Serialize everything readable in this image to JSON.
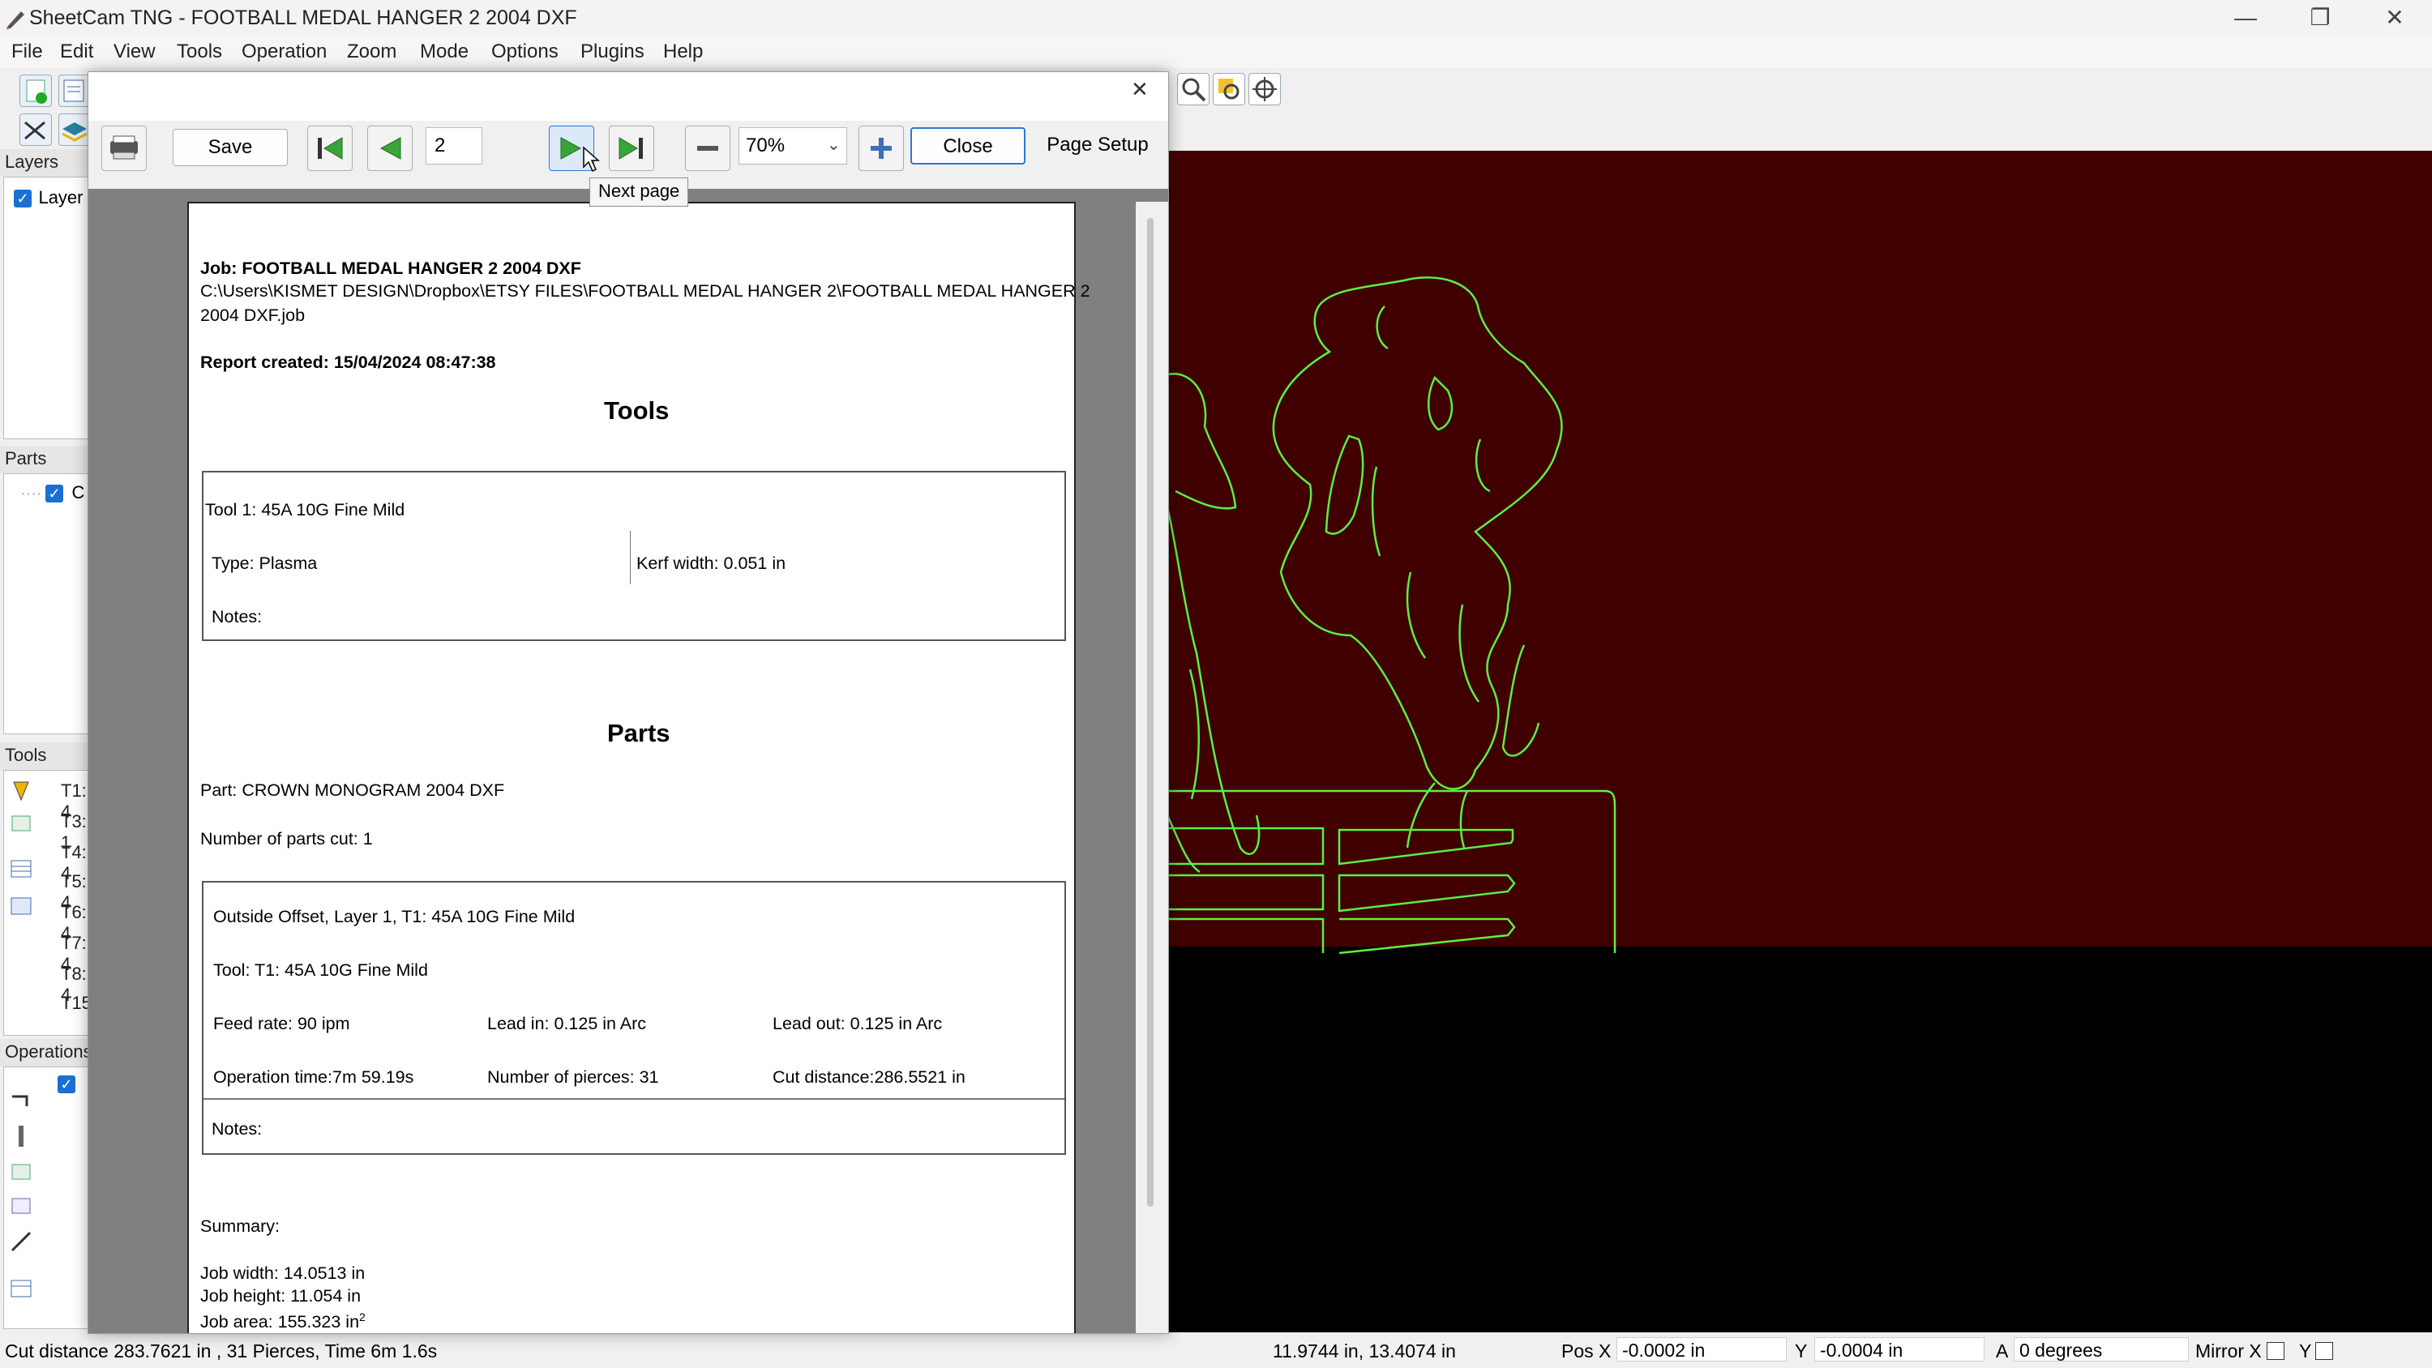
{
  "window": {
    "title": "SheetCam TNG - FOOTBALL MEDAL HANGER 2 2004 DXF",
    "minimize_glyph": "—",
    "restore_glyph": "❐",
    "close_glyph": "✕"
  },
  "menu": [
    "File",
    "Edit",
    "View",
    "Tools",
    "Operation",
    "Zoom",
    "Mode",
    "Options",
    "Plugins",
    "Help"
  ],
  "panels": {
    "layers": {
      "title": "Layers",
      "item": "Layer"
    },
    "parts": {
      "title": "Parts",
      "item": "C"
    },
    "tools": {
      "title": "Tools",
      "items": [
        "T1: 4",
        "T3: 1",
        "T4: 4",
        "T5: 4",
        "T6: 4",
        "T7: 4",
        "T8: 4",
        "T15"
      ]
    },
    "operations": {
      "title": "Operations"
    }
  },
  "dialog": {
    "close_glyph": "✕",
    "save_label": "Save",
    "page_number": "2",
    "zoom_value": "70%",
    "close_label": "Close",
    "page_setup_label": "Page Setup",
    "tooltip": "Next page"
  },
  "report": {
    "job_line": "Job: FOOTBALL MEDAL HANGER 2 2004 DXF",
    "path_line1": "C:\\Users\\KISMET DESIGN\\Dropbox\\ETSY FILES\\FOOTBALL MEDAL HANGER 2\\FOOTBALL MEDAL HANGER 2",
    "path_line2": "2004 DXF.job",
    "created": "Report created: 15/04/2024 08:47:38",
    "tools_heading": "Tools",
    "tool1": "Tool 1: 45A 10G Fine Mild",
    "type": "Type: Plasma",
    "kerf": "Kerf width: 0.051 in",
    "notes": "Notes:",
    "parts_heading": "Parts",
    "part": "Part: CROWN MONOGRAM 2004 DXF",
    "parts_cut": "Number of parts cut: 1",
    "op_title": "Outside Offset, Layer 1, T1: 45A 10G Fine Mild",
    "op_tool": "Tool: T1: 45A 10G Fine Mild",
    "feed": "Feed rate: 90 ipm",
    "lead_in": "Lead in: 0.125 in Arc",
    "lead_out": "Lead out: 0.125 in Arc",
    "op_time": "Operation time:7m 59.19s",
    "pierces": "Number of pierces: 31",
    "cut_distance": "Cut distance:286.5521 in",
    "op_notes": "Notes:",
    "summary": "Summary:",
    "job_width": "Job width: 14.0513 in",
    "job_height": "Job height: 11.054 in",
    "job_area": "Job area: 155.323 in",
    "job_area_sup": "2"
  },
  "status": {
    "left": "Cut distance 283.7621 in , 31 Pierces, Time 6m 1.6s",
    "coords": "11.9744 in, 13.4074 in",
    "pos_x_label": "Pos X",
    "pos_x_value": "-0.0002 in",
    "y_label": "Y",
    "y_value": "-0.0004 in",
    "a_label": "A",
    "a_value": "0 degrees",
    "mirror_x_label": "Mirror X",
    "mirror_y_label": "Y"
  },
  "colors": {
    "canvas_red": "#400000",
    "outline_green": "#5cf040",
    "checkbox_blue": "#1a6fd1"
  }
}
